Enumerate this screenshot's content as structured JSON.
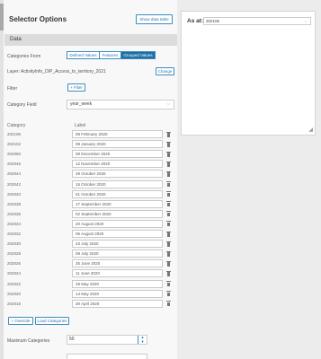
{
  "panel": {
    "title": "Selector Options",
    "show_data_table": "Show data table",
    "section_data": "Data",
    "categories_from_label": "Categories From",
    "categories_from_options": [
      "Defined Values",
      "Features",
      "Grouped Values"
    ],
    "categories_from_selected": "Grouped Values",
    "layer_text": "Layer: ActivityInfo_DIP_Access_to_territory_2021",
    "change_label": "Change",
    "filter_label": "Filter",
    "filter_button": "+ Filter",
    "category_field_label": "Category Field",
    "category_field_value": "year_week",
    "col_category": "Category",
    "col_label": "Label",
    "rows": [
      {
        "category": "202106",
        "label": "08 February 2020"
      },
      {
        "category": "202102",
        "label": "08 January 2020"
      },
      {
        "category": "202050",
        "label": "08 December 2020"
      },
      {
        "category": "202046",
        "label": "12 November 2020"
      },
      {
        "category": "202044",
        "label": "29 October 2020"
      },
      {
        "category": "202042",
        "label": "15 October 2020"
      },
      {
        "category": "202040",
        "label": "01 October 2020"
      },
      {
        "category": "202038",
        "label": "17 September 2020"
      },
      {
        "category": "202036",
        "label": "02 September 2020"
      },
      {
        "category": "202034",
        "label": "20 August 2020"
      },
      {
        "category": "202032",
        "label": "06 August 2020"
      },
      {
        "category": "202030",
        "label": "23 July 2020"
      },
      {
        "category": "202028",
        "label": "09 July 2020"
      },
      {
        "category": "202026",
        "label": "25 June 2020"
      },
      {
        "category": "202024",
        "label": "11 June 2020"
      },
      {
        "category": "202022",
        "label": "29 May 2020"
      },
      {
        "category": "202020",
        "label": "14 May 2020"
      },
      {
        "category": "202018",
        "label": "30 April 2020"
      }
    ],
    "override_button": "+ Override",
    "load_categories_button": "Load Categories",
    "max_categories_label": "Maximum Categories",
    "max_categories_value": "50"
  },
  "preview": {
    "as_at_label": "As at:",
    "as_at_value": "202106"
  },
  "colors": {
    "accent": "#1e6fa6",
    "accent_border": "#3b8dbd",
    "panel_bg": "#f8f8f8",
    "page_bg": "#ececec"
  }
}
